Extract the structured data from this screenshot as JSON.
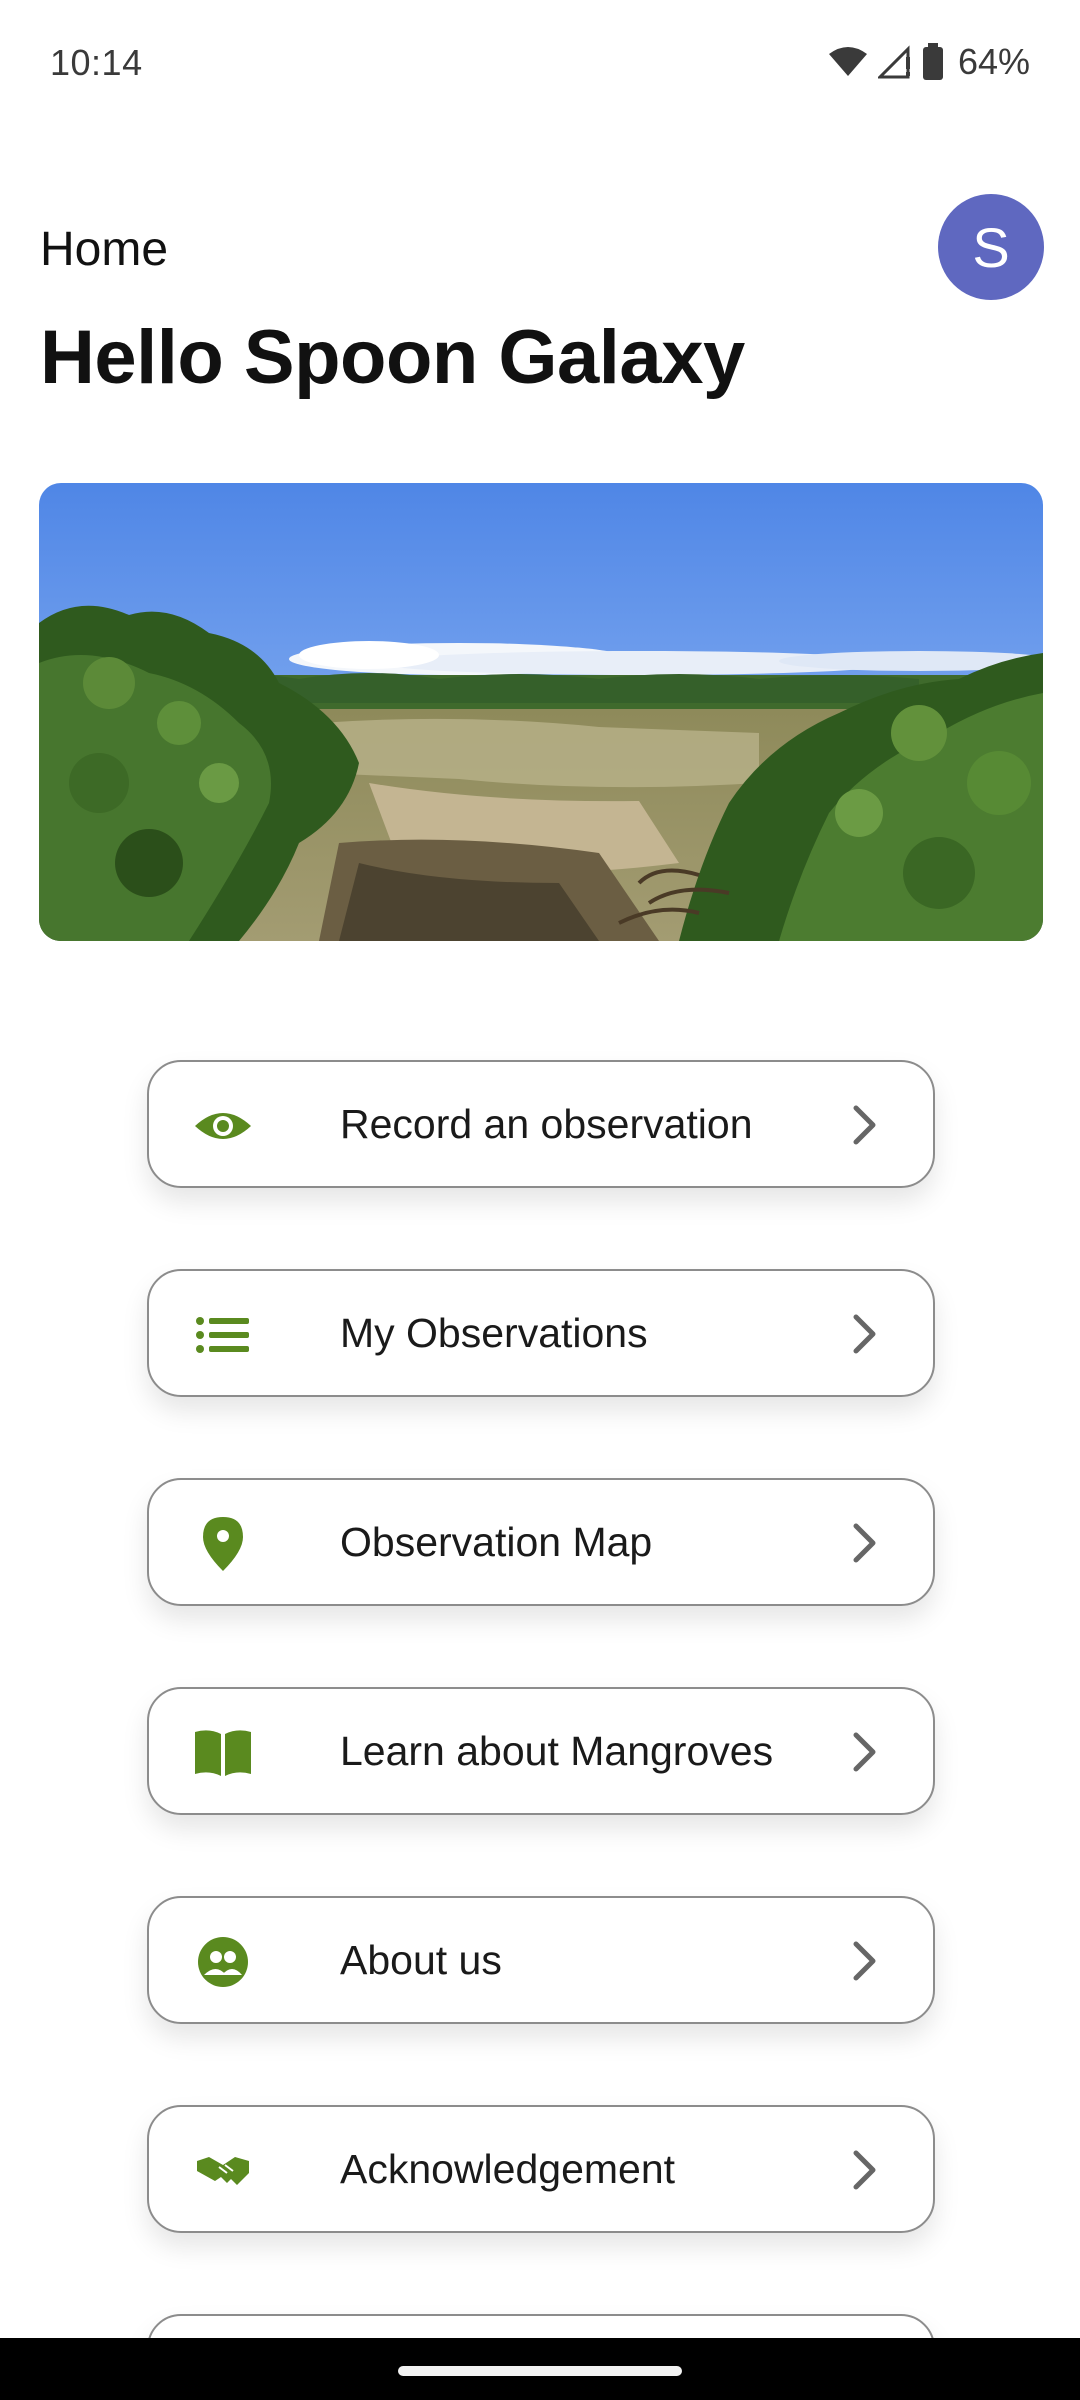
{
  "status_bar": {
    "time": "10:14",
    "battery": "64%"
  },
  "header": {
    "section": "Home",
    "greeting": "Hello Spoon Galaxy",
    "avatar_initial": "S",
    "avatar_color": "#5f68c0"
  },
  "menu": {
    "accent_color": "#5a8a1f",
    "items": [
      {
        "label": "Record an observation",
        "icon": "eye-icon"
      },
      {
        "label": "My Observations",
        "icon": "list-icon"
      },
      {
        "label": "Observation Map",
        "icon": "map-pin-icon"
      },
      {
        "label": "Learn about Mangroves",
        "icon": "book-icon"
      },
      {
        "label": "About us",
        "icon": "people-icon"
      },
      {
        "label": "Acknowledgement",
        "icon": "handshake-icon"
      }
    ]
  }
}
